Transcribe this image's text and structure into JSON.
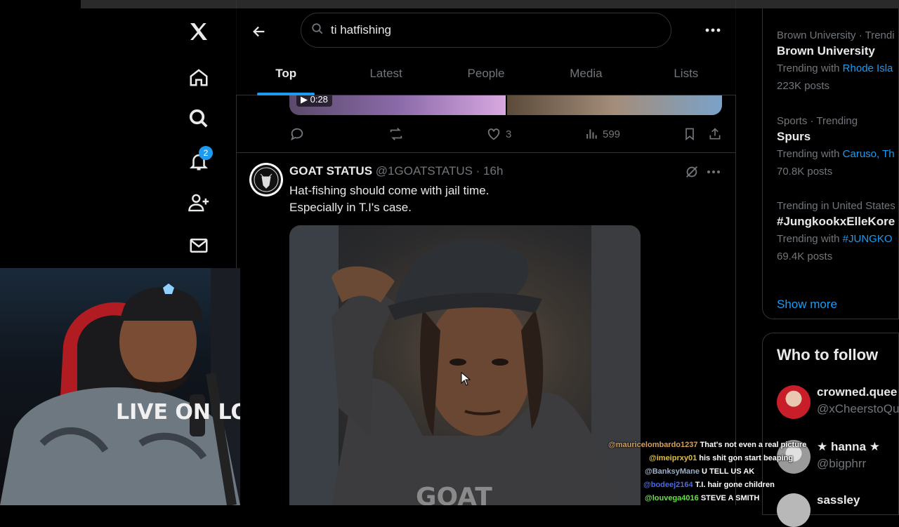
{
  "search": {
    "query": "ti hatfishing"
  },
  "notifications": {
    "badge_count": "2"
  },
  "tabs": [
    {
      "label": "Top",
      "active": true
    },
    {
      "label": "Latest",
      "active": false
    },
    {
      "label": "People",
      "active": false
    },
    {
      "label": "Media",
      "active": false
    },
    {
      "label": "Lists",
      "active": false
    }
  ],
  "prev_tweet": {
    "video_duration": "0:28",
    "likes": "3",
    "views": "599"
  },
  "tweet": {
    "display_name": "GOAT STATUS",
    "meta": "@1GOATSTATUS · 16h",
    "text_line1": "Hat-fishing should come with jail time.",
    "text_line2": "Especially in T.I's case."
  },
  "trends": [
    {
      "category": "Brown University · Trendi",
      "title": "Brown University",
      "with_prefix": "Trending with",
      "with_link": "Rhode Isla",
      "posts": "223K posts"
    },
    {
      "category": "Sports · Trending",
      "title": "Spurs",
      "with_prefix": "Trending with",
      "with_link": "Caruso, Th",
      "posts": "70.8K posts"
    },
    {
      "category": "Trending in United States",
      "title": "#JungkookxElleKore",
      "with_prefix": "Trending with",
      "with_link": "#JUNGKO",
      "posts": "69.4K posts"
    }
  ],
  "show_more": "Show more",
  "who_to_follow": {
    "title": "Who to follow",
    "users": [
      {
        "name": "crowned.quee",
        "handle": "@xCheerstoQu"
      },
      {
        "name": "★ hanna ★",
        "handle": "@bigphrr"
      },
      {
        "name": "sassley",
        "handle": ""
      }
    ]
  },
  "chat": [
    {
      "user": "@mauricelombardo1237",
      "msg": "That's not even a real picture",
      "color": "#d4a05a"
    },
    {
      "user": "@imeiprxy01",
      "msg": "his shit gon start beaping",
      "color": "#e0c040"
    },
    {
      "user": "@BanksyMane",
      "msg": "U TELL US AK",
      "color": "#9ab0c8"
    },
    {
      "user": "@bodeej2164",
      "msg": "T.I. hair gone children",
      "color": "#4a6ae0"
    },
    {
      "user": "@louvega4016",
      "msg": "STEVE A SMITH",
      "color": "#6ae04a"
    }
  ],
  "webcam": {
    "shirt_text": "LIVE ON LOKE"
  },
  "photo": {
    "shirt_text": "GOAT"
  },
  "colors": {
    "accent": "#1d9bf0",
    "bg": "#000000",
    "border": "#2f3336",
    "muted": "#71767b"
  }
}
